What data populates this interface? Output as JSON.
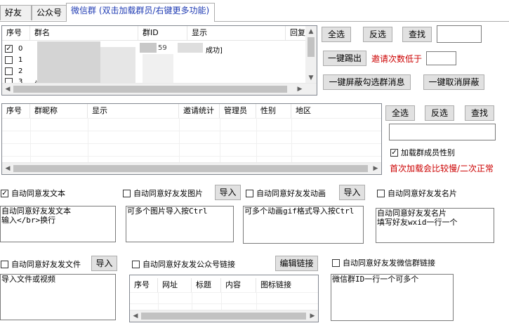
{
  "tabs": [
    {
      "label": "好友"
    },
    {
      "label": "公众号"
    },
    {
      "label": "微信群 (双击加载群员/右键更多功能)"
    }
  ],
  "group_table": {
    "columns": [
      "序号",
      "群名",
      "群ID",
      "显示",
      "回复"
    ],
    "rows": [
      {
        "index": "0",
        "id_fragment": "59",
        "display": "成功]",
        "checked": true
      },
      {
        "index": "1",
        "checked": false
      },
      {
        "index": "2",
        "checked": false
      },
      {
        "index": "3",
        "name_fragment": "信",
        "checked": false
      }
    ]
  },
  "group_actions": {
    "select_all": "全选",
    "invert": "反选",
    "find": "查找",
    "one_key_kick": "一键踢出",
    "invite_label": "邀请次数低于",
    "one_key_block": "一键屏蔽勾选群消息",
    "one_key_unblock": "一键取消屏蔽"
  },
  "member_table": {
    "columns": [
      "序号",
      "群昵称",
      "显示",
      "邀请统计",
      "管理员",
      "性别",
      "地区"
    ]
  },
  "member_actions": {
    "select_all": "全选",
    "invert": "反选",
    "find": "查找",
    "load_gender": "加载群成员性别",
    "load_gender_checked": true,
    "note": "首次加载会比较慢/二次正常"
  },
  "auto": {
    "text_label": "自动同意发文本",
    "text_checked": true,
    "text_memo": "自动同意好友发文本\n输入</br>换行",
    "image_label": "自动同意好友发图片",
    "image_memo": "可多个图片导入按Ctrl",
    "anim_label": "自动同意好友发动画",
    "anim_memo": "可多个动画gif格式导入按Ctrl",
    "card_label": "自动同意好友发名片",
    "card_memo": "自动同意好友发名片\n填写好友wxid一行一个",
    "file_label": "自动同意好友发文件",
    "file_memo": "导入文件或视频",
    "mp_label": "自动同意好友发公众号链接",
    "edit_link": "编辑链接",
    "group_link_label": "自动同意好友发微信群链接",
    "group_link_memo": "微信群ID一行一个可多个",
    "import": "导入"
  },
  "link_table": {
    "columns": [
      "序号",
      "网址",
      "标题",
      "内容",
      "图标链接"
    ]
  }
}
